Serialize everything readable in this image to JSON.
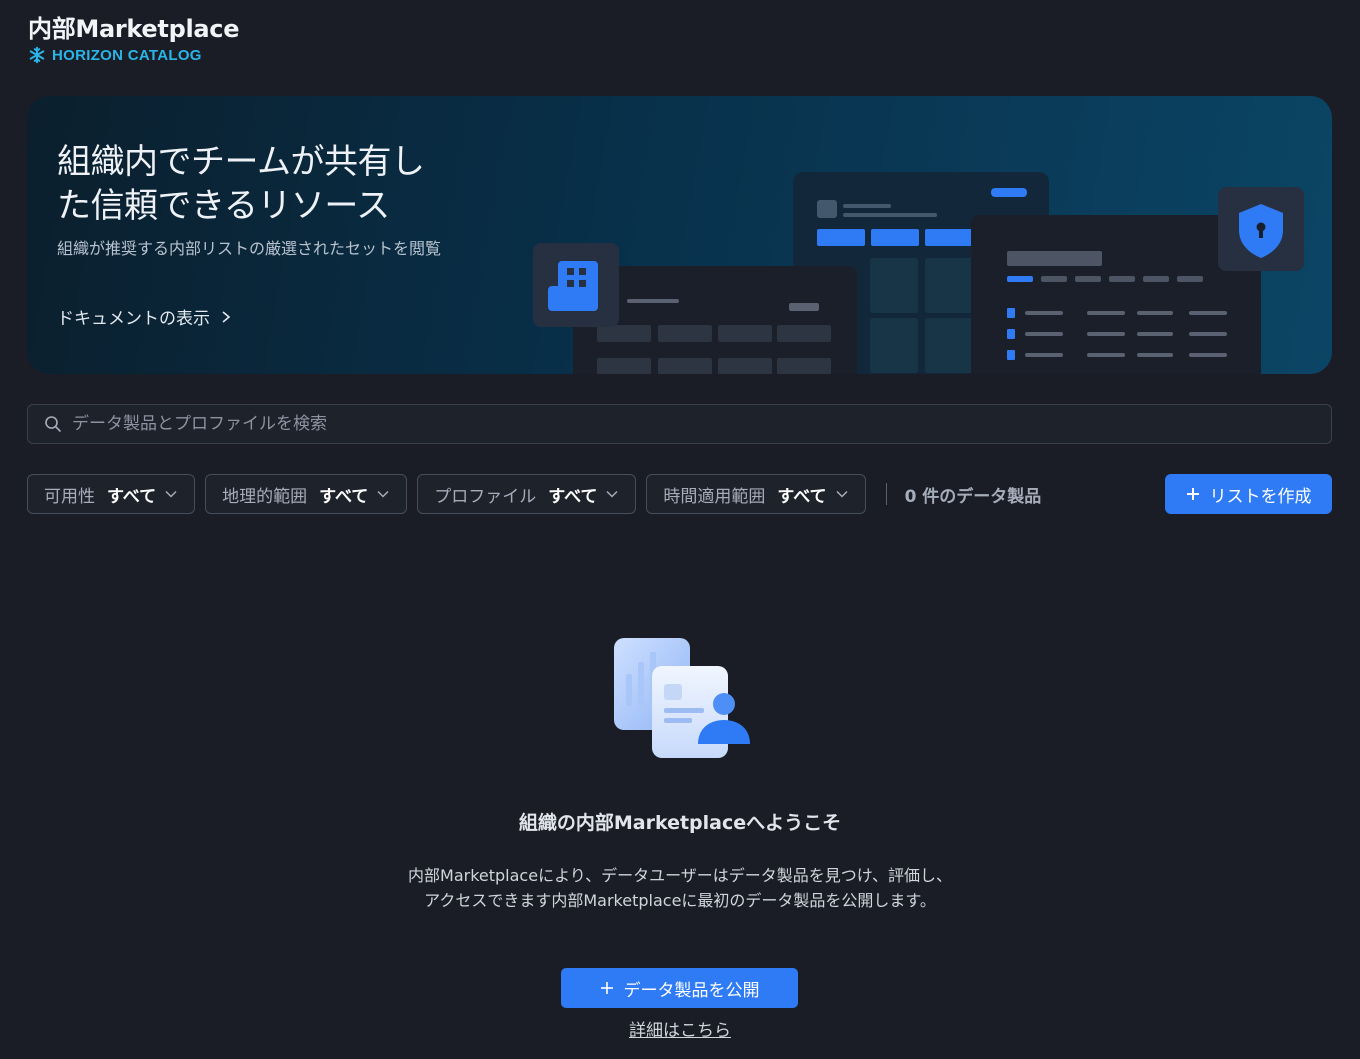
{
  "header": {
    "title": "内部Marketplace",
    "brand": "HORIZON CATALOG",
    "brand_icon": "snowflake-icon",
    "brand_color": "#29b5e8"
  },
  "hero": {
    "title": "組織内でチームが共有した信頼できるリソース",
    "subtitle": "組織が推奨する内部リストの厳選されたセットを閲覧",
    "link_label": "ドキュメントの表示"
  },
  "search": {
    "placeholder": "データ製品とプロファイルを検索",
    "value": ""
  },
  "filters": [
    {
      "label": "可用性",
      "value": "すべて"
    },
    {
      "label": "地理的範囲",
      "value": "すべて"
    },
    {
      "label": "プロファイル",
      "value": "すべて"
    },
    {
      "label": "時間適用範囲",
      "value": "すべて"
    }
  ],
  "result_count": "0 件のデータ製品",
  "create_button": "リストを作成",
  "empty_state": {
    "title": "組織の内部Marketplaceへようこそ",
    "description": "内部Marketplaceにより、データユーザーはデータ製品を見つけ、評価し、アクセスできます内部Marketplaceに最初のデータ製品を公開します。",
    "publish_button": "データ製品を公開",
    "learn_more": "詳細はこちら"
  },
  "colors": {
    "accent": "#2f7bf5",
    "background": "#1a1d25"
  }
}
